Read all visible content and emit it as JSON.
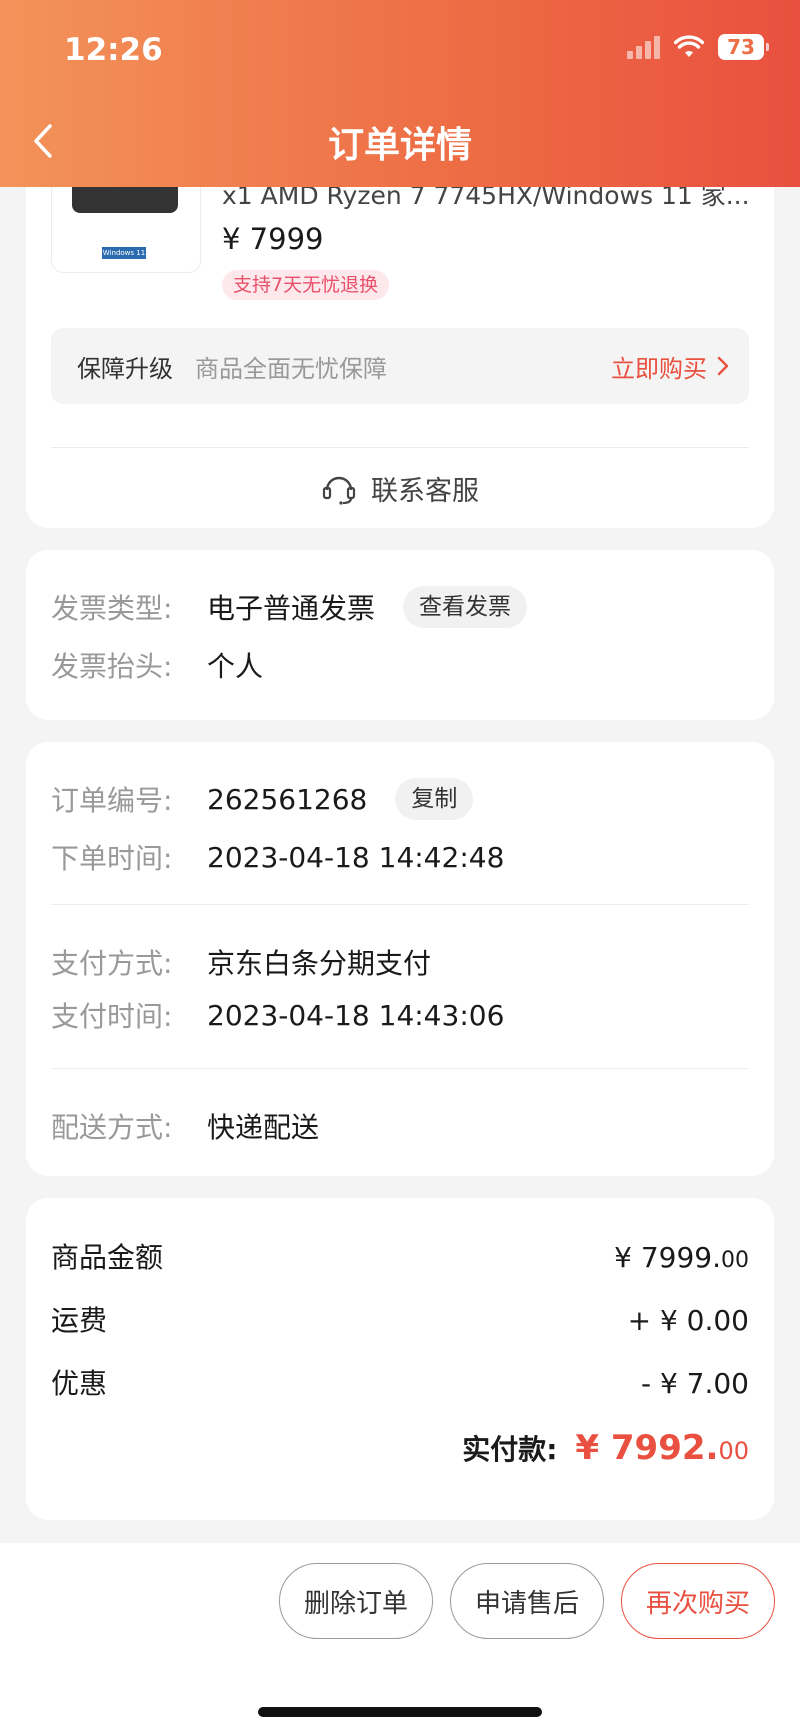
{
  "status_bar": {
    "time": "12:26",
    "battery": "73"
  },
  "header": {
    "title": "订单详情"
  },
  "product": {
    "title": "x1 AMD Ryzen 7 7745HX/Windows 11 家...",
    "price": "¥ 7999",
    "return_badge": "支持7天无忧退换",
    "thumb_badge": "Windows 11"
  },
  "upgrade": {
    "label": "保障升级",
    "desc": "商品全面无忧保障",
    "buy": "立即购买"
  },
  "service": {
    "label": "联系客服"
  },
  "invoice": {
    "type_label": "发票类型:",
    "type_value": "电子普通发票",
    "view_btn": "查看发票",
    "title_label": "发票抬头:",
    "title_value": "个人"
  },
  "order": {
    "number_label": "订单编号:",
    "number_value": "262561268",
    "copy_btn": "复制",
    "time_label": "下单时间:",
    "time_value": "2023-04-18 14:42:48",
    "pay_method_label": "支付方式:",
    "pay_method_value": "京东白条分期支付",
    "pay_time_label": "支付时间:",
    "pay_time_value": "2023-04-18 14:43:06",
    "delivery_label": "配送方式:",
    "delivery_value": "快递配送"
  },
  "amounts": {
    "goods_label": "商品金额",
    "goods_int": "¥ 7999.",
    "goods_dec": "00",
    "shipping_label": "运费",
    "shipping_value": "+ ¥ 0.00",
    "discount_label": "优惠",
    "discount_value": "- ¥ 7.00",
    "total_label": "实付款:",
    "total_int": "¥ 7992.",
    "total_dec": "00"
  },
  "actions": {
    "delete": "删除订单",
    "aftersale": "申请售后",
    "rebuy": "再次购买"
  },
  "colors": {
    "accent": "#e9503f",
    "header_start": "#f3935a",
    "header_end": "#e9503f"
  }
}
